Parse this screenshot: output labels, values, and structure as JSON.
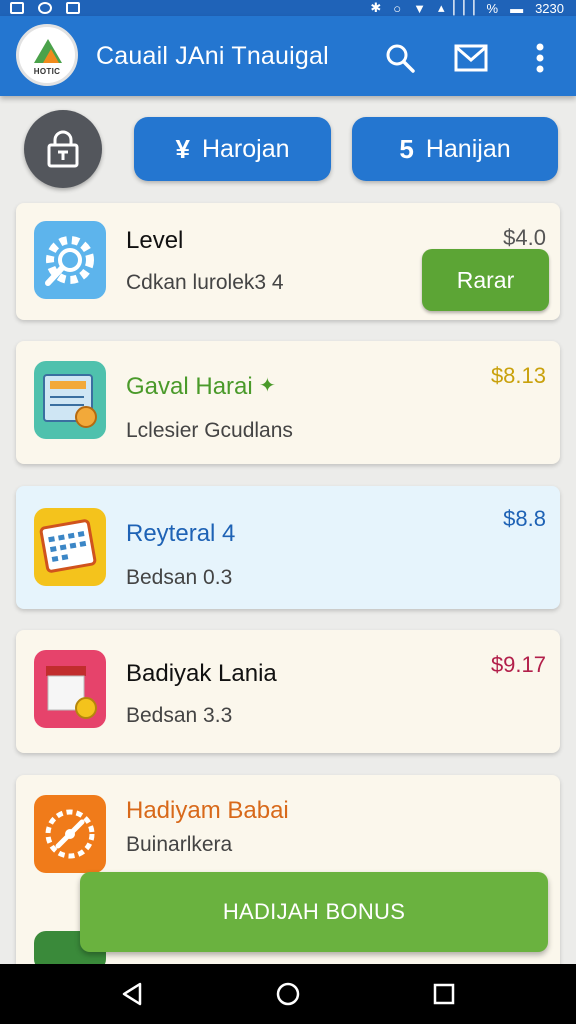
{
  "status_bar": {
    "signal": "▴▕▕▕",
    "battery_percent": "%",
    "time": "3230"
  },
  "app": {
    "logo_text": "HOTIC",
    "title": "Cauail JAni Tnauigal"
  },
  "actions": {
    "pill_1": {
      "icon": "¥",
      "label": "Harojan"
    },
    "pill_2": {
      "icon": "5",
      "label": "Hanijan"
    }
  },
  "cards": [
    {
      "title": "Level",
      "subtitle": "Cdkan lurolek3 4",
      "price": "$4.0",
      "button": "Rarar",
      "title_color": "#111111",
      "price_color": "#555555"
    },
    {
      "title": "Gaval Harai",
      "subtitle": "Lclesier Gcudlans",
      "price": "$8.13",
      "title_color": "#4a9a2a",
      "price_color": "#c9a10c"
    },
    {
      "title": "Reyteral 4",
      "subtitle": "Bedsan 0.3",
      "price": "$8.8",
      "title_color": "#1e62b5",
      "price_color": "#1e62b5"
    },
    {
      "title": "Badiyak Lania",
      "subtitle": "Bedsan 3.3",
      "price": "$9.17",
      "title_color": "#111111",
      "price_color": "#b21f4a"
    },
    {
      "title": "Hadiyam Babai",
      "subtitle": "Buinarlkera",
      "title_color": "#d8691a"
    }
  ],
  "bonus_button": "HADIJAH BONUS",
  "colors": {
    "primary": "#2476d0",
    "accent_green": "#5ca535"
  }
}
